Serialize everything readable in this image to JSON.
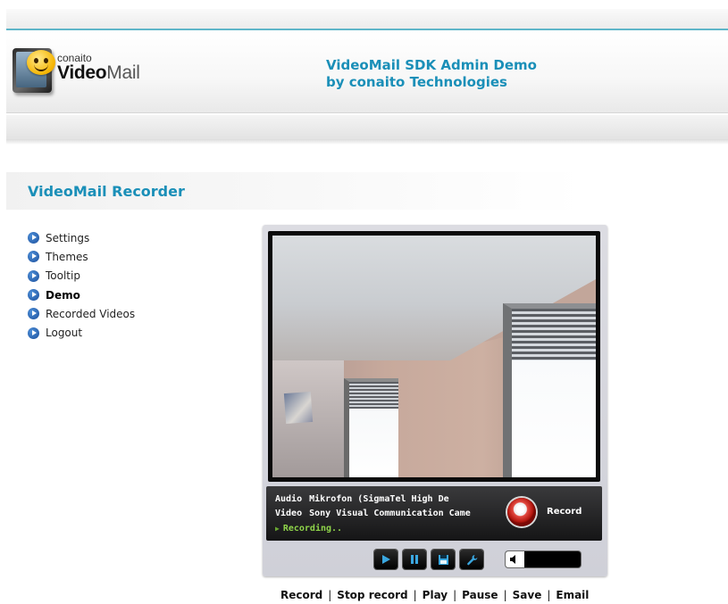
{
  "header": {
    "logo_small": "conaito",
    "logo_brand_bold": "Video",
    "logo_brand_light": "Mail",
    "title_line1": "VideoMail SDK Admin Demo",
    "title_line2": "by conaito Technologies"
  },
  "section": {
    "title": "VideoMail Recorder"
  },
  "menu": {
    "items": [
      {
        "label": "Settings",
        "active": false
      },
      {
        "label": "Themes",
        "active": false
      },
      {
        "label": "Tooltip",
        "active": false
      },
      {
        "label": "Demo",
        "active": true
      },
      {
        "label": "Recorded Videos",
        "active": false
      },
      {
        "label": "Logout",
        "active": false
      }
    ]
  },
  "recorder": {
    "audio_key": "Audio",
    "audio_value": "Mikrofon (SigmaTel High De",
    "video_key": "Video",
    "video_value": "Sony Visual Communication Came",
    "status": "Recording..",
    "record_label": "Record",
    "controls": [
      "play-icon",
      "pause-icon",
      "save-icon",
      "settings-wrench-icon"
    ],
    "volume_level": 0.25
  },
  "links": [
    "Record",
    "Stop record",
    "Play",
    "Pause",
    "Save",
    "Email"
  ],
  "colors": {
    "accent": "#1a8fb8",
    "top_line": "#5fb6c9",
    "status_green": "#8fd44a",
    "record_red": "#c8231a",
    "menu_icon": "#2a65b8"
  }
}
